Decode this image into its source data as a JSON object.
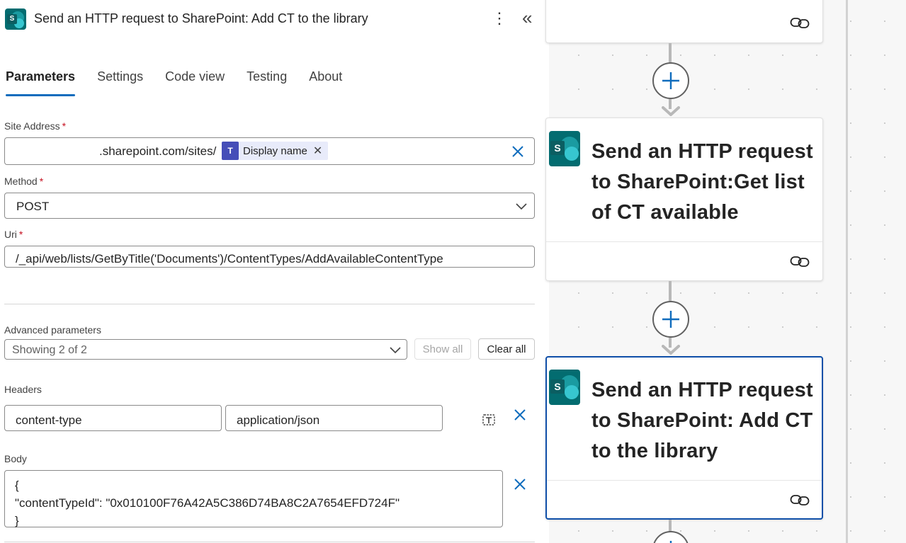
{
  "panel": {
    "title": "Send an HTTP request to SharePoint: Add CT to the library",
    "more_glyph": "⋮",
    "collapse_glyph": "«",
    "tabs": [
      {
        "label": "Parameters",
        "active": true
      },
      {
        "label": "Settings",
        "active": false
      },
      {
        "label": "Code view",
        "active": false
      },
      {
        "label": "Testing",
        "active": false
      },
      {
        "label": "About",
        "active": false
      }
    ],
    "site_address": {
      "label": "Site Address",
      "required_mark": "*",
      "value_text": ".sharepoint.com/sites/",
      "token_label": "Display name",
      "token_remove": "✕"
    },
    "method": {
      "label": "Method",
      "required_mark": "*",
      "value": "POST"
    },
    "uri": {
      "label": "Uri",
      "required_mark": "*",
      "value": "/_api/web/lists/GetByTitle('Documents')/ContentTypes/AddAvailableContentType"
    },
    "advanced": {
      "label": "Advanced parameters",
      "value": "Showing 2 of 2",
      "show_all": "Show all",
      "clear_all": "Clear all"
    },
    "headers": {
      "label": "Headers",
      "key": "content-type",
      "value": "application/json"
    },
    "body": {
      "label": "Body",
      "line1": "{",
      "line2": "\"contentTypeId\": \"0x010100F76A42A5C386D74BA8C2A7654EFD724F\"",
      "line3": "}"
    }
  },
  "canvas": {
    "cards": [
      {
        "title": "",
        "selected": false
      },
      {
        "title": "Send an HTTP request to SharePoint:Get list of CT available",
        "selected": false
      },
      {
        "title": "Send an HTTP request to SharePoint: Add CT to the library",
        "selected": true
      }
    ]
  },
  "colors": {
    "accent": "#0f6cbd",
    "sharepoint_teal": "#036c70",
    "required": "#c50f1f",
    "selected_border": "#0f4fa8"
  },
  "icons": [
    "sharepoint-icon",
    "more-icon",
    "collapse-icon",
    "close-icon",
    "chevron-down-icon",
    "teams-icon",
    "insert-expression-icon",
    "link-icon",
    "plus-icon"
  ]
}
